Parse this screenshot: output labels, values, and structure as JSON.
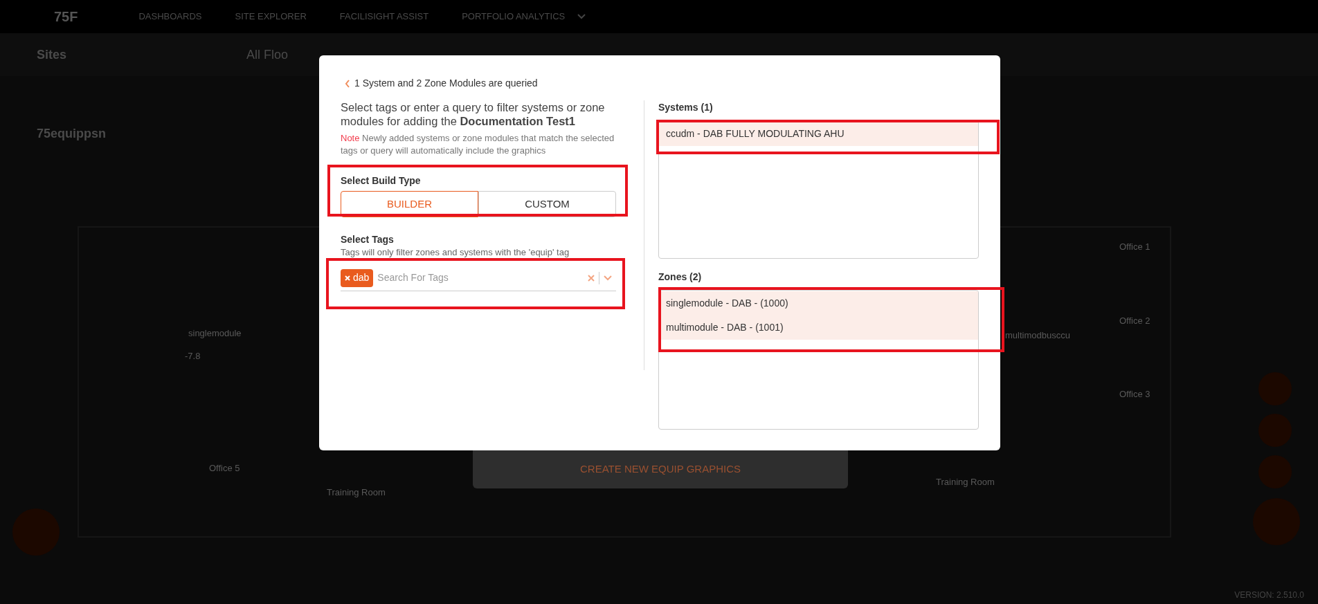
{
  "top_nav": {
    "logo": "75F",
    "items": [
      {
        "label": "DASHBOARDS",
        "selected": false
      },
      {
        "label": "SITE EXPLORER",
        "selected": false
      },
      {
        "label": "FACILISIGHT ASSIST",
        "selected": false
      },
      {
        "label": "PORTFOLIO ANALYTICS",
        "selected": false
      }
    ]
  },
  "toolbar": {
    "sites_label": "Sites",
    "floor_select": "All Floo"
  },
  "page": {
    "title": "75equippsn",
    "create_button": "CREATE NEW EQUIP GRAPHICS",
    "version": "VERSION: 2.510.0"
  },
  "floor_plan": {
    "rooms": [
      "singlemodule",
      "-7.8",
      "Office 5",
      "Training Room",
      "multimodbusccu",
      "Office 1",
      "Office 2",
      "Office 3",
      "Training Room"
    ]
  },
  "dialog": {
    "back_label": "1 System and 2 Zone Modules are queried",
    "intro": "Select tags or enter a query to filter systems or zone modules for adding the **Documentation Test1**",
    "note_label": "Note",
    "note_text": "Newly added systems or zone modules that match the selected tags or query will automatically include the graphics",
    "build_type": {
      "label": "Select Build Type",
      "options": [
        {
          "label": "BUILDER",
          "selected": true
        },
        {
          "label": "CUSTOM",
          "selected": false
        }
      ]
    },
    "tags": {
      "label": "Select Tags",
      "hint": "Tags will only filter zones and systems with the 'equip' tag",
      "chips": [
        "dab"
      ],
      "placeholder": "Search For Tags"
    },
    "systems": {
      "title": "Systems (1)",
      "items": [
        {
          "label": "ccudm - DAB FULLY MODULATING AHU",
          "selected": true
        }
      ]
    },
    "zones": {
      "title": "Zones (2)",
      "items": [
        {
          "label": "singlemodule - DAB - (1000)",
          "selected": true
        },
        {
          "label": "multimodule - DAB - (1001)",
          "selected": true
        }
      ]
    }
  }
}
